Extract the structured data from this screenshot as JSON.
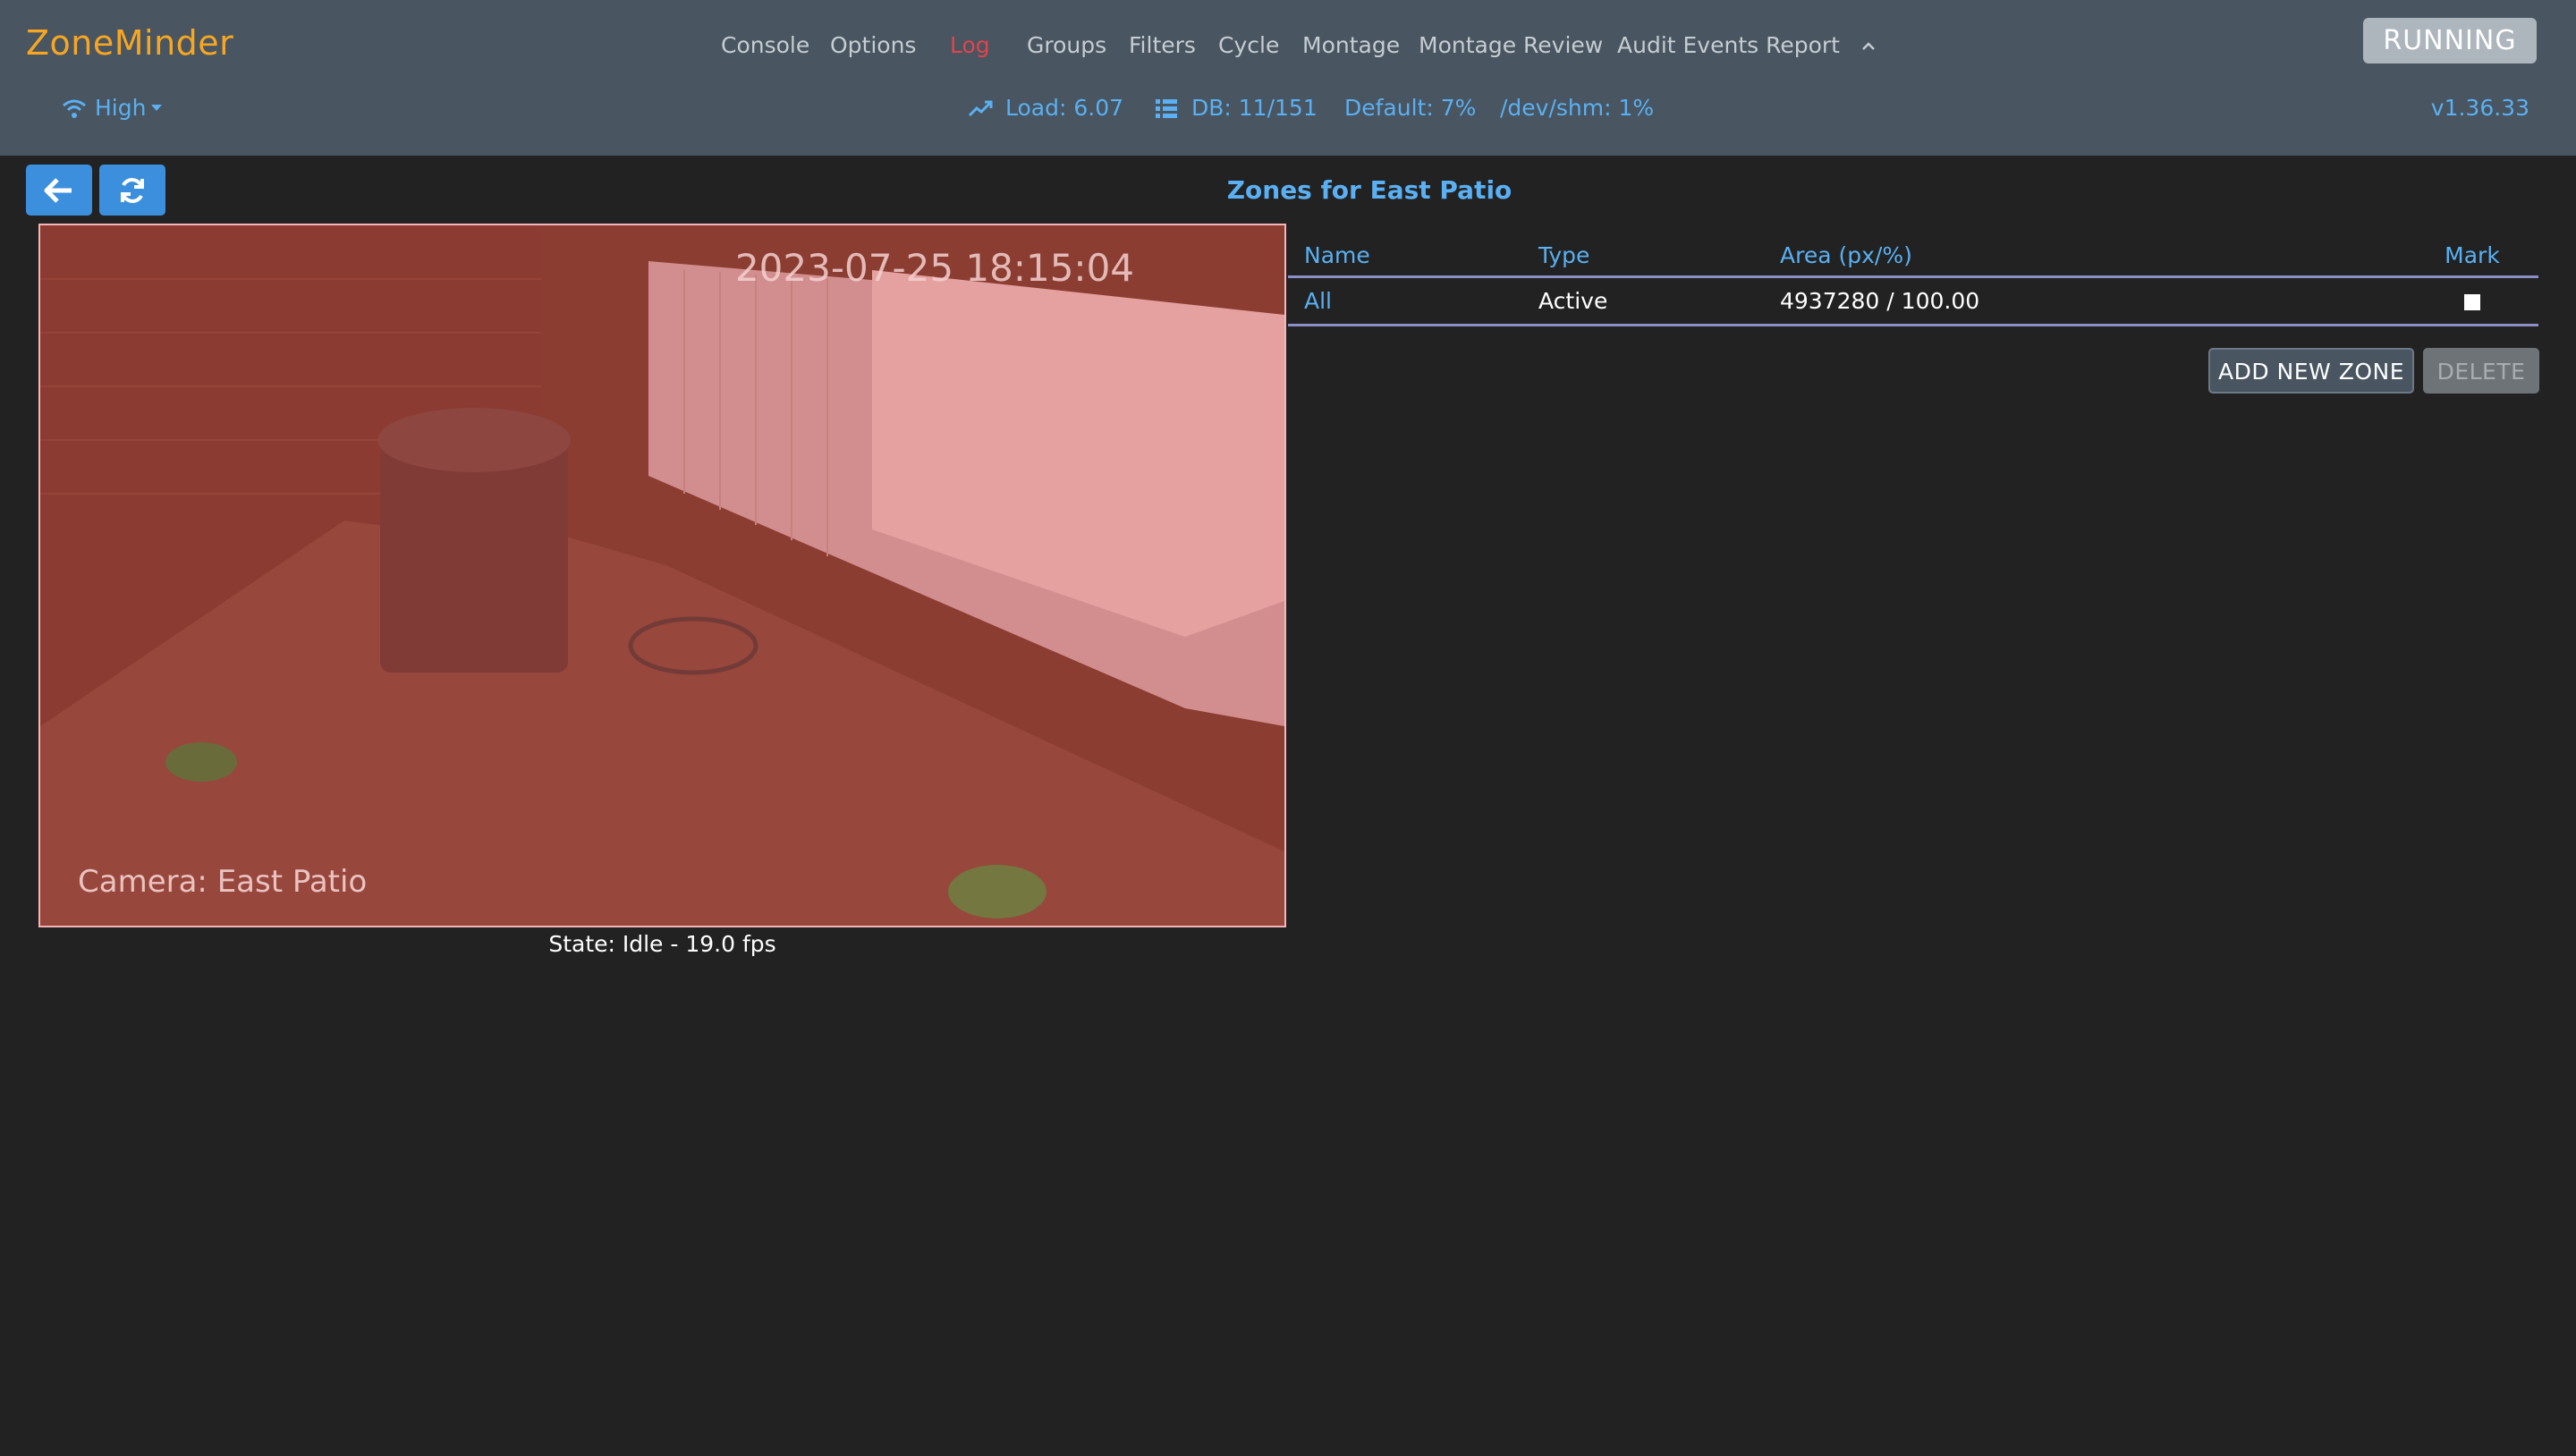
{
  "app": {
    "brand": "ZoneMinder",
    "status": "RUNNING",
    "version": "v1.36.33"
  },
  "nav": {
    "items": [
      {
        "label": "Console"
      },
      {
        "label": "Options"
      },
      {
        "label": "Log"
      },
      {
        "label": "Groups"
      },
      {
        "label": "Filters"
      },
      {
        "label": "Cycle"
      },
      {
        "label": "Montage"
      },
      {
        "label": "Montage Review"
      },
      {
        "label": "Audit Events Report"
      }
    ],
    "active": "Log"
  },
  "subbar": {
    "bandwidth": "High",
    "load": "Load: 6.07",
    "db": "DB: 11/151",
    "default_disk": "Default: 7%",
    "shm": "/dev/shm: 1%"
  },
  "page": {
    "title": "Zones for East Patio"
  },
  "camera": {
    "timestamp": "2023-07-25 18:15:04",
    "overlay_label": "Camera: East Patio",
    "state": "State: Idle - 19.0 fps"
  },
  "table": {
    "headers": [
      "Name",
      "Type",
      "Area (px/%)",
      "Mark"
    ],
    "rows": [
      {
        "name": "All",
        "type": "Active",
        "area": "4937280 / 100.00",
        "mark": false
      }
    ]
  },
  "actions": {
    "add": "ADD NEW ZONE",
    "delete": "DELETE"
  },
  "colors": {
    "header_bg": "#495560",
    "page_bg": "#222222",
    "brand": "#f6a623",
    "link": "#5ab0f2",
    "active_nav": "#e1444e",
    "button_primary": "#3b8fdc"
  }
}
